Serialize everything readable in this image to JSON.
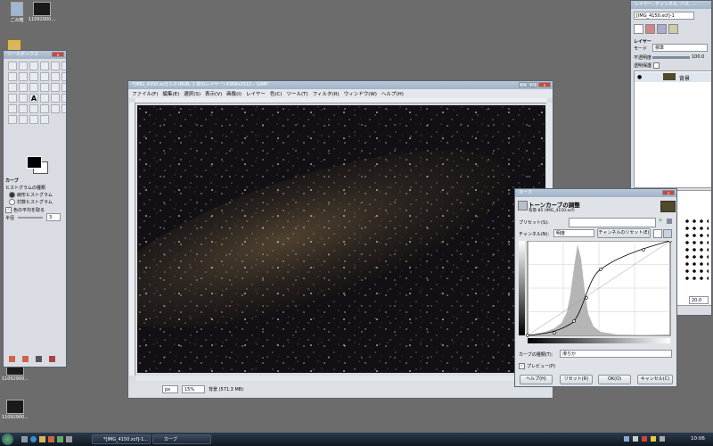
{
  "desktop": {
    "icons": [
      {
        "label": "ごみ箱"
      },
      {
        "label": "11092900..."
      },
      {
        "label": "11092900..."
      },
      {
        "label": "11092900..."
      }
    ]
  },
  "toolbox": {
    "title": "ツールボックス",
    "section_title": "カーブ",
    "histogram_type_label": "ヒストグラムの種類",
    "linear_label": "線形ヒストグラム",
    "log_label": "対数ヒストグラム",
    "average_label": "色の平均を取る",
    "radius_label": "半径",
    "radius_value": "3"
  },
  "image_window": {
    "title": "*[IMG_4150.xcf]-1.0 (RGB, 1 枚のレイヤー) 4368x2912 – GIMP",
    "menu": [
      "ファイル(F)",
      "編集(E)",
      "選択(S)",
      "表示(V)",
      "画像(I)",
      "レイヤー",
      "色(C)",
      "ツール(T)",
      "フィルタ(R)",
      "ウィンドウ(W)",
      "ヘルプ(H)"
    ],
    "status_unit": "px",
    "status_zoom": "15%",
    "status_text": "背景 (571.3 MB)"
  },
  "layers_panel": {
    "title": "レイヤー, チャンネル, パス, ...",
    "image_select": "[IMG_4150.xcf]-1",
    "section": "レイヤー",
    "mode_label": "モード",
    "mode_value": "標準",
    "opacity_label": "不透明度",
    "opacity_value": "100.0",
    "lock_label": "透明保護",
    "layer_name": "背景",
    "brush_size": "20.0"
  },
  "curves_dialog": {
    "title": "カーブ",
    "heading": "トーンカーブの調整",
    "subheading": "背景-85 (IMG_4150.xcf)",
    "preset_label": "プリセット(S):",
    "channel_label": "チャンネル(N):",
    "channel_value": "明度",
    "reset_channel": "チャンネルのリセット(E)",
    "curve_type_label": "カーブの種類(T):",
    "curve_type_value": "滑らか",
    "preview_label": "プレビュー(P)",
    "buttons": {
      "help": "ヘルプ(H)",
      "reset": "リセット(R)",
      "ok": "OK(O)",
      "cancel": "キャンセル(C)"
    }
  },
  "taskbar": {
    "tasks": [
      "*[IMG_4150.xcf]-1...",
      "カーブ"
    ],
    "clock": "10:06"
  }
}
